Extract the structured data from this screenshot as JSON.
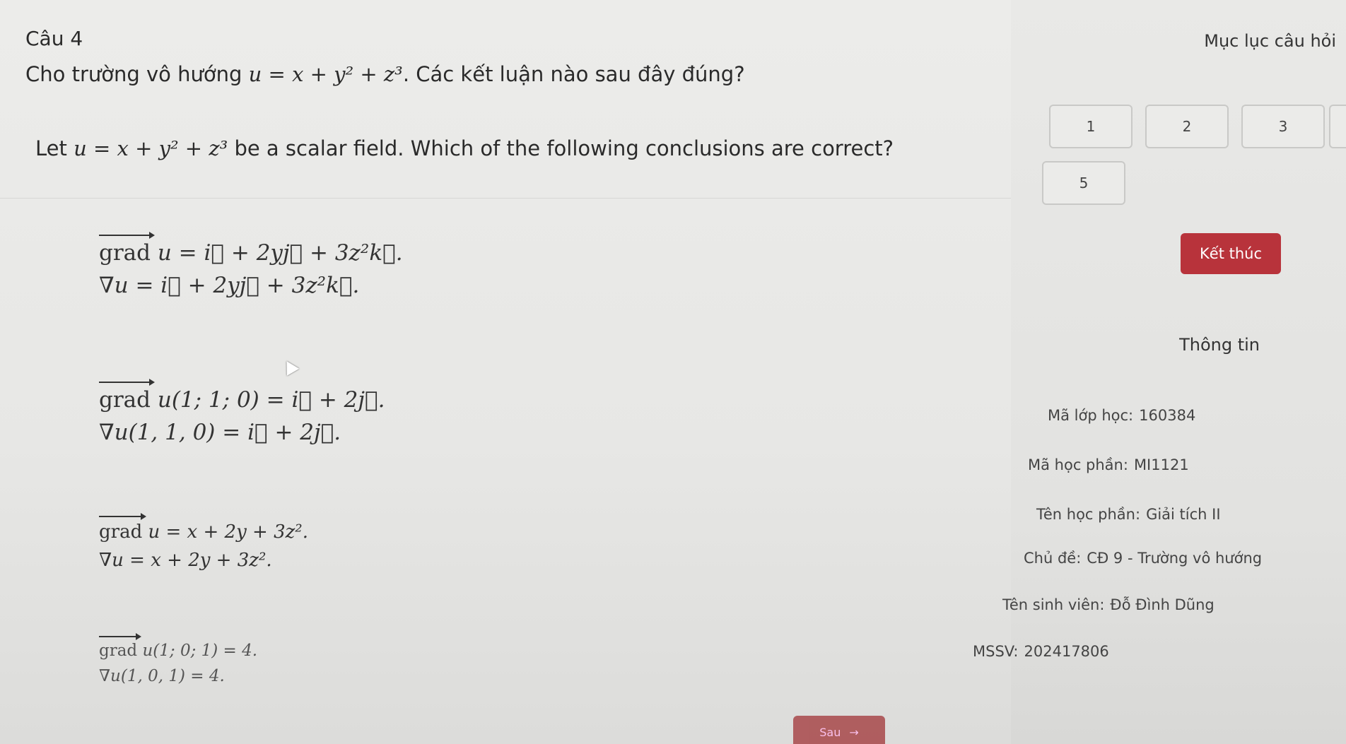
{
  "question": {
    "number": "Câu 4",
    "text_vi_before": "Cho trường vô hướng ",
    "formula": "u = x + y² + z³",
    "text_vi_after": ". Các kết luận nào sau đây đúng?",
    "text_en_before": "Let ",
    "text_en_after": " be a scalar field. Which of the following conclusions are correct?"
  },
  "options": [
    {
      "grad_label": "grad",
      "line1": " u = i⃗ + 2yj⃗ + 3z²k⃗.",
      "line2": "∇u = i⃗ + 2yj⃗ + 3z²k⃗."
    },
    {
      "grad_label": "grad",
      "line1": " u(1; 1; 0) = i⃗ + 2j⃗.",
      "line2": "∇u(1, 1, 0) = i⃗ + 2j⃗."
    },
    {
      "grad_label": "grad",
      "line1": " u = x + 2y + 3z².",
      "line2": "∇u = x + 2y + 3z²."
    },
    {
      "grad_label": "grad",
      "line1": " u(1; 0; 1) = 4.",
      "line2": "∇u(1, 0, 1) = 4."
    }
  ],
  "sidebar": {
    "title": "Mục lục câu hỏi",
    "question_buttons": [
      "1",
      "2",
      "3",
      "5"
    ],
    "finish_label": "Kết thúc",
    "info_title": "Thông tin",
    "info": [
      {
        "label": "Mã lớp học:",
        "value": "160384"
      },
      {
        "label": "Mã học phần:",
        "value": "MI1121"
      },
      {
        "label": "Tên học phần:",
        "value": "Giải tích II"
      },
      {
        "label": "Chủ đề:",
        "value": "CĐ 9 - Trường vô hướng"
      },
      {
        "label": "Tên sinh viên:",
        "value": "Đỗ Đình Dũng"
      },
      {
        "label": "MSSV:",
        "value": "202417806"
      }
    ]
  },
  "next_button": {
    "label": "Sau",
    "arrow": "→"
  },
  "colors": {
    "accent": "#b8333b",
    "background": "#e6e6e4"
  }
}
